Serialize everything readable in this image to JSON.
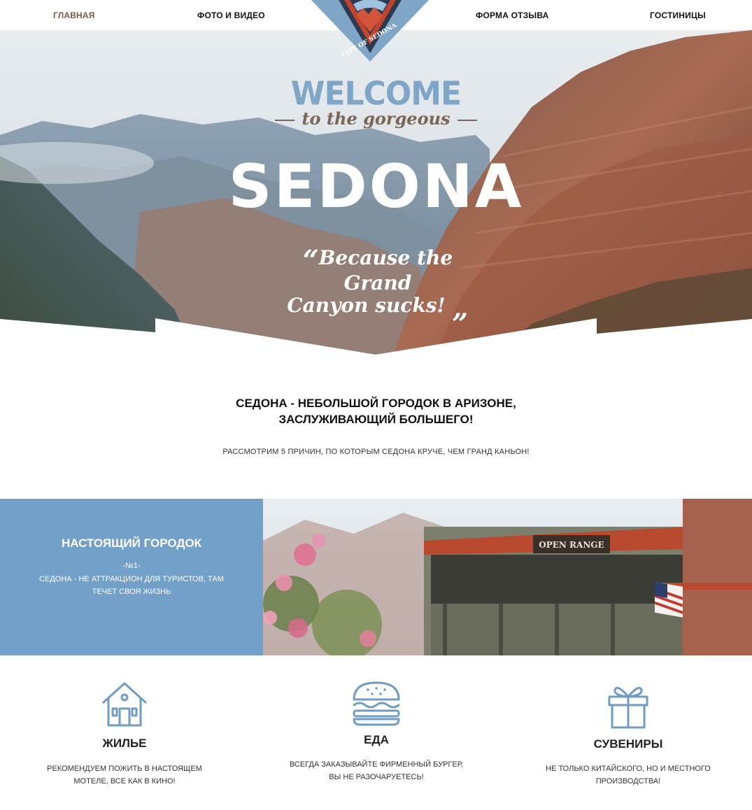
{
  "nav": {
    "items": [
      "ГЛАВНАЯ",
      "ФОТО И ВИДЕО",
      "ФОРМА ОТЗЫВА",
      "ГОСТИНИЦЫ"
    ],
    "logo_text": "CITY OF SEDONA"
  },
  "hero": {
    "welcome": "WELCOME",
    "subtitle": "to the gorgeous",
    "title": "SEDONA",
    "quote_line1": "Because the Grand",
    "quote_line2": "Canyon sucks!",
    "quote_open": "“",
    "quote_close": "„"
  },
  "intro": {
    "title_line1": "СЕДОНА - НЕБОЛЬШОЙ ГОРОДОК В АРИЗОНЕ,",
    "title_line2": "ЗАСЛУЖИВАЮЩИЙ БОЛЬШЕГО!",
    "subtitle": "РАССМОТРИМ 5 ПРИЧИН, ПО КОТОРЫМ СЕДОНА КРУЧЕ, ЧЕМ ГРАНД КАНЬОН!"
  },
  "feature": {
    "title": "НАСТОЯЩИЙ ГОРОДОК",
    "number": "-№1-",
    "description": "СЕДОНА - НЕ АТТРАКЦИОН ДЛЯ ТУРИСТОВ, ТАМ ТЕЧЕТ СВОЯ ЖИЗНЬ",
    "photo_sign": "OPEN RANGE"
  },
  "columns": [
    {
      "icon": "house-icon",
      "title": "ЖИЛЬЕ",
      "line1": "РЕКОМЕНДУЕМ ПОЖИТЬ В НАСТОЯЩЕМ",
      "line2": "МОТЕЛЕ, ВСЕ КАК В КИНО!"
    },
    {
      "icon": "burger-icon",
      "title": "ЕДА",
      "line1": "ВСЕГДА ЗАКАЗЫВАЙТЕ ФИРМЕННЫЙ БУРГЕР,",
      "line2": "ВЫ НЕ РАЗОЧАРУЕТЕСЬ!"
    },
    {
      "icon": "gift-icon",
      "title": "СУВЕНИРЫ",
      "line1": "НЕ ТОЛЬКО КИТАЙСКОГО, НО И МЕСТНОГО",
      "line2": "ПРОИЗВОДСТВА!"
    }
  ],
  "colors": {
    "accent_blue": "#73a0c8",
    "nav_active": "#7a5a45",
    "icon_blue": "#6f9cc5"
  }
}
